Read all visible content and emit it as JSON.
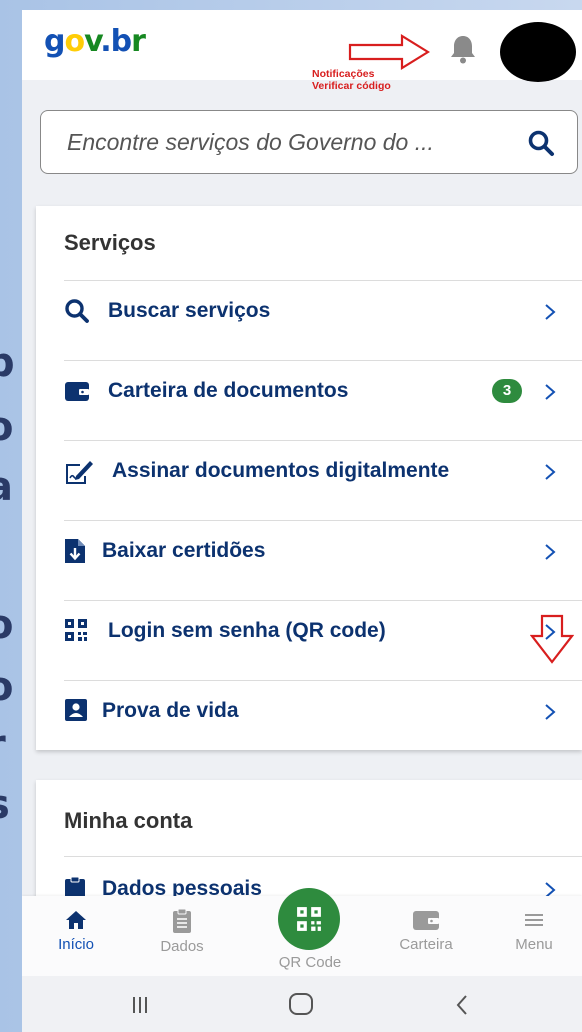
{
  "header": {
    "logo": {
      "g": "g",
      "o": "o",
      "v": "v",
      "dot": ".",
      "b": "b",
      "r": "r"
    },
    "annotation_line1": "Notificações",
    "annotation_line2": "Verificar código"
  },
  "search": {
    "placeholder": "Encontre serviços do Governo do ..."
  },
  "services": {
    "title": "Serviços",
    "items": [
      {
        "label": "Buscar serviços",
        "icon": "search-icon"
      },
      {
        "label": "Carteira de documentos",
        "icon": "wallet-icon",
        "badge": "3"
      },
      {
        "label": "Assinar documentos digitalmente",
        "icon": "signature-icon"
      },
      {
        "label": "Baixar certidões",
        "icon": "file-download-icon"
      },
      {
        "label": "Login sem senha (QR code)",
        "icon": "qrcode-icon"
      },
      {
        "label": "Prova de vida",
        "icon": "id-card-icon"
      }
    ]
  },
  "account": {
    "title": "Minha conta",
    "items": [
      {
        "label": "Dados pessoais",
        "icon": "clipboard-icon"
      }
    ]
  },
  "bottom_nav": {
    "items": [
      {
        "label": "Início",
        "icon": "home-icon",
        "active": true
      },
      {
        "label": "Dados",
        "icon": "clipboard-icon"
      },
      {
        "label": "QR Code",
        "icon": "qrcode-icon"
      },
      {
        "label": "Carteira",
        "icon": "wallet-icon"
      },
      {
        "label": "Menu",
        "icon": "hamburger-icon"
      }
    ]
  },
  "colors": {
    "primary_blue": "#1351b4",
    "dark_blue": "#0c326f",
    "green": "#2e8b3e",
    "annotation_red": "#d81e1e"
  }
}
